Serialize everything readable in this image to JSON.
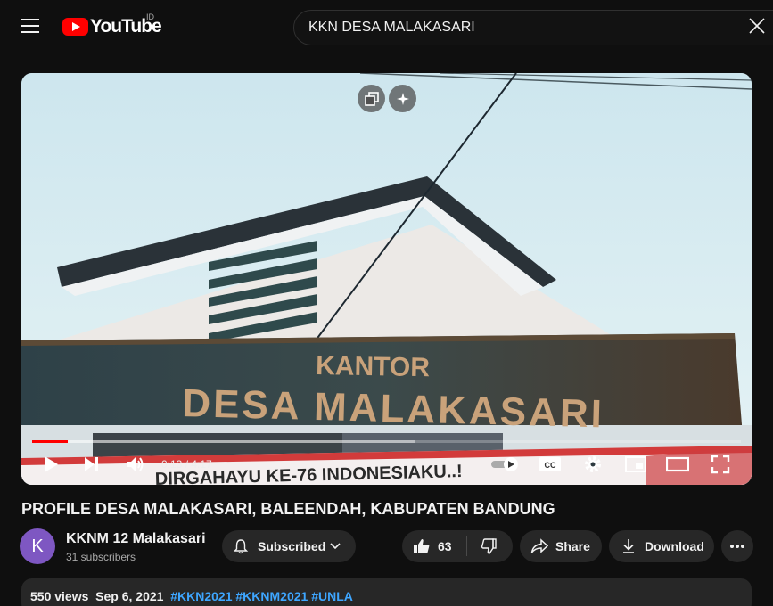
{
  "header": {
    "logo_text": "YouTube",
    "region": "ID",
    "search_value": "KKN DESA MALAKASARI"
  },
  "player": {
    "sign_line1": "KANTOR",
    "sign_line2": "DESA MALAKASARI",
    "banner_text": "DIRGAHAYU KE-76 INDONESIAKU..!",
    "current_time": "0:13",
    "duration": "4:17",
    "time_display": "0:13 / 4:17",
    "progress_fraction": 0.05,
    "buffer_fraction": 0.54,
    "autoplay": true,
    "cc_label": "CC"
  },
  "video": {
    "title": "PROFILE DESA MALAKASARI, BALEENDAH, KABUPATEN BANDUNG"
  },
  "channel": {
    "avatar_letter": "K",
    "name": "KKNM 12 Malakasari",
    "subscribers": "31 subscribers",
    "avatar_color": "#7e57c2"
  },
  "actions": {
    "subscribed_label": "Subscribed",
    "like_count": "63",
    "share_label": "Share",
    "download_label": "Download"
  },
  "description": {
    "views": "550 views",
    "date": "Sep 6, 2021",
    "hashtags": [
      "#KKN2021",
      "#KKNM2021",
      "#UNLA"
    ]
  },
  "colors": {
    "accent": "#ff0000",
    "link": "#3ea6ff",
    "pill_bg": "#272727",
    "page_bg": "#0f0f0f"
  }
}
